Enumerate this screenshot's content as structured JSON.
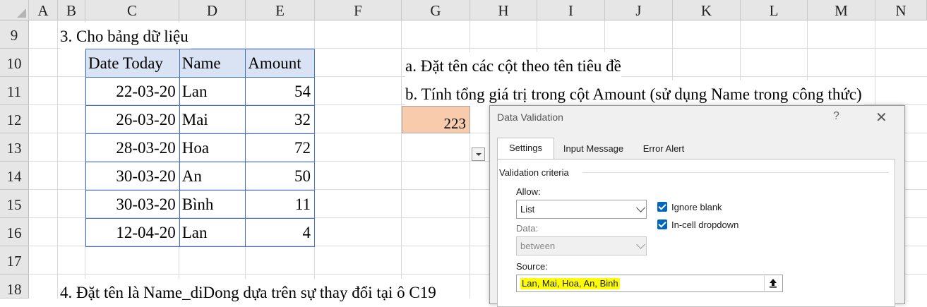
{
  "columns": [
    "A",
    "B",
    "C",
    "D",
    "E",
    "F",
    "G",
    "H",
    "I",
    "J",
    "K",
    "L",
    "M",
    "N"
  ],
  "rows": [
    "9",
    "10",
    "11",
    "12",
    "13",
    "14",
    "15",
    "16",
    "17",
    "18"
  ],
  "sheet": {
    "section3_title": "3. Cho bảng dữ liệu",
    "section4_title": "4. Đặt tên là Name_diDong dựa trên sự thay đổi tại ô C19",
    "task_a": "a. Đặt tên các cột theo tên tiêu đề",
    "task_b": "b. Tính tổng giá trị trong cột Amount (sử dụng Name trong công thức)",
    "sum_value": "223"
  },
  "table": {
    "headers": [
      "Date Today",
      "Name",
      "Amount"
    ],
    "rows": [
      {
        "date": "22-03-20",
        "name": "Lan",
        "amount": "54"
      },
      {
        "date": "26-03-20",
        "name": "Mai",
        "amount": "32"
      },
      {
        "date": "28-03-20",
        "name": "Hoa",
        "amount": "72"
      },
      {
        "date": "30-03-20",
        "name": "An",
        "amount": "50"
      },
      {
        "date": "30-03-20",
        "name": "Bình",
        "amount": "11"
      },
      {
        "date": "12-04-20",
        "name": "Lan",
        "amount": "4"
      }
    ]
  },
  "dialog": {
    "title": "Data Validation",
    "help": "?",
    "close": "✕",
    "tabs": [
      "Settings",
      "Input Message",
      "Error Alert"
    ],
    "active_tab": "Settings",
    "validation_criteria": "Validation criteria",
    "allow_label": "Allow:",
    "allow_value": "List",
    "data_label": "Data:",
    "data_value": "between",
    "ignore_blank": "Ignore blank",
    "in_cell_dropdown": "In-cell dropdown",
    "source_label": "Source:",
    "source_value": "Lan, Mai, Hoa, An, Binh"
  },
  "colors": {
    "header_fill": "#dae3f3",
    "table_border": "#4472c4",
    "sum_fill": "#f8cbad",
    "highlight": "#ffff00",
    "checkbox": "#0067c0"
  }
}
